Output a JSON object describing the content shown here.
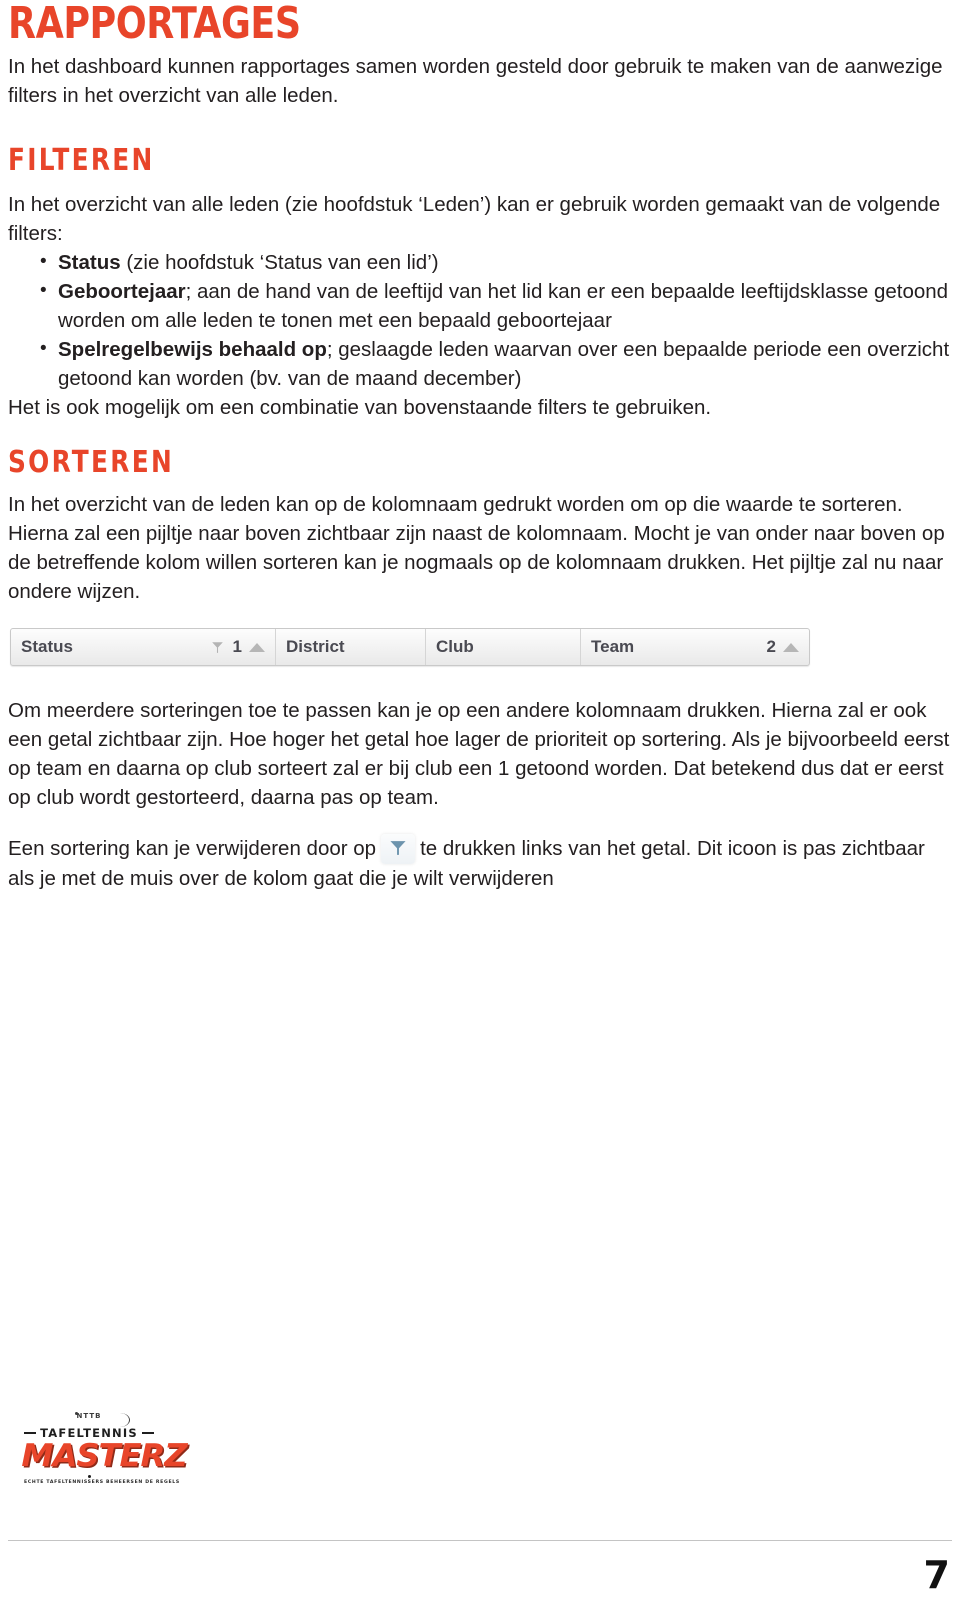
{
  "document": {
    "title": "RAPPORTAGES",
    "intro": "In het dashboard kunnen rapportages samen worden gesteld door gebruik te maken van de aanwezige filters in het overzicht van alle leden.",
    "page_number": "7"
  },
  "sections": {
    "filteren": {
      "heading": "FILTEREN",
      "intro": "In het overzicht van alle leden (zie hoofdstuk ‘Leden’) kan er gebruik worden gemaakt van de volgende filters:",
      "items": [
        {
          "bold": "Status",
          "rest": " (zie hoofdstuk ‘Status van een lid’)"
        },
        {
          "bold": "Geboortejaar",
          "rest": "; aan de hand van de leeftijd van het lid kan er een bepaalde leeftijdsklasse getoond worden om alle leden te tonen met een bepaald geboortejaar"
        },
        {
          "bold": "Spelregelbewijs behaald op",
          "rest": "; geslaagde leden waarvan over een bepaalde periode een overzicht getoond kan worden (bv. van de maand december)"
        }
      ],
      "outro": "Het is ook mogelijk om een combinatie van bovenstaande filters te gebruiken."
    },
    "sorteren": {
      "heading": "SORTEREN",
      "intro": "In het overzicht van de leden kan op de kolomnaam gedrukt worden om op die waarde te sorteren. Hierna zal een pijltje naar boven zichtbaar zijn naast de kolomnaam. Mocht je van onder naar boven op de betreffende kolom willen sorteren kan je nogmaals op de kolomnaam drukken. Het pijltje zal nu naar ondere wijzen.",
      "after_figure": "Om meerdere sorteringen toe te passen kan je op een andere kolomnaam drukken. Hierna zal er ook een getal zichtbaar zijn. Hoe hoger het getal hoe lager de prioriteit op sortering. Als je bijvoorbeeld eerst op team en daarna op club sorteert zal er bij club een 1 getoond worden. Dat betekend dus dat er eerst op club wordt gestorteerd, daarna pas op team.",
      "remove_sort_before": "Een sortering kan je verwijderen door op",
      "remove_sort_after": "te drukken links van het getal. Dit icoon is pas zichtbaar als je met de muis over de kolom gaat die je wilt verwijderen"
    }
  },
  "table_figure": {
    "columns": [
      {
        "label": "Status",
        "sort_rank": "1",
        "sort_direction": "ascending",
        "has_remove_icon": true
      },
      {
        "label": "District",
        "sort_rank": "",
        "sort_direction": "",
        "has_remove_icon": false
      },
      {
        "label": "Club",
        "sort_rank": "",
        "sort_direction": "",
        "has_remove_icon": false
      },
      {
        "label": "Team",
        "sort_rank": "2",
        "sort_direction": "ascending",
        "has_remove_icon": false
      }
    ]
  },
  "logo": {
    "swoosh_text": "NTTB",
    "subtitle": "TAFELTENNIS",
    "wordmark": "MASTERZ",
    "tagline": "ECHTE TAFELTENNISSERS BEHEERSEN DE REGELS"
  },
  "colors": {
    "accent": "#e8452a",
    "text": "#231f20",
    "table_header_text": "#4a4a52",
    "caret": "#b6b6b6",
    "remove_icon": "#6d94ad"
  }
}
